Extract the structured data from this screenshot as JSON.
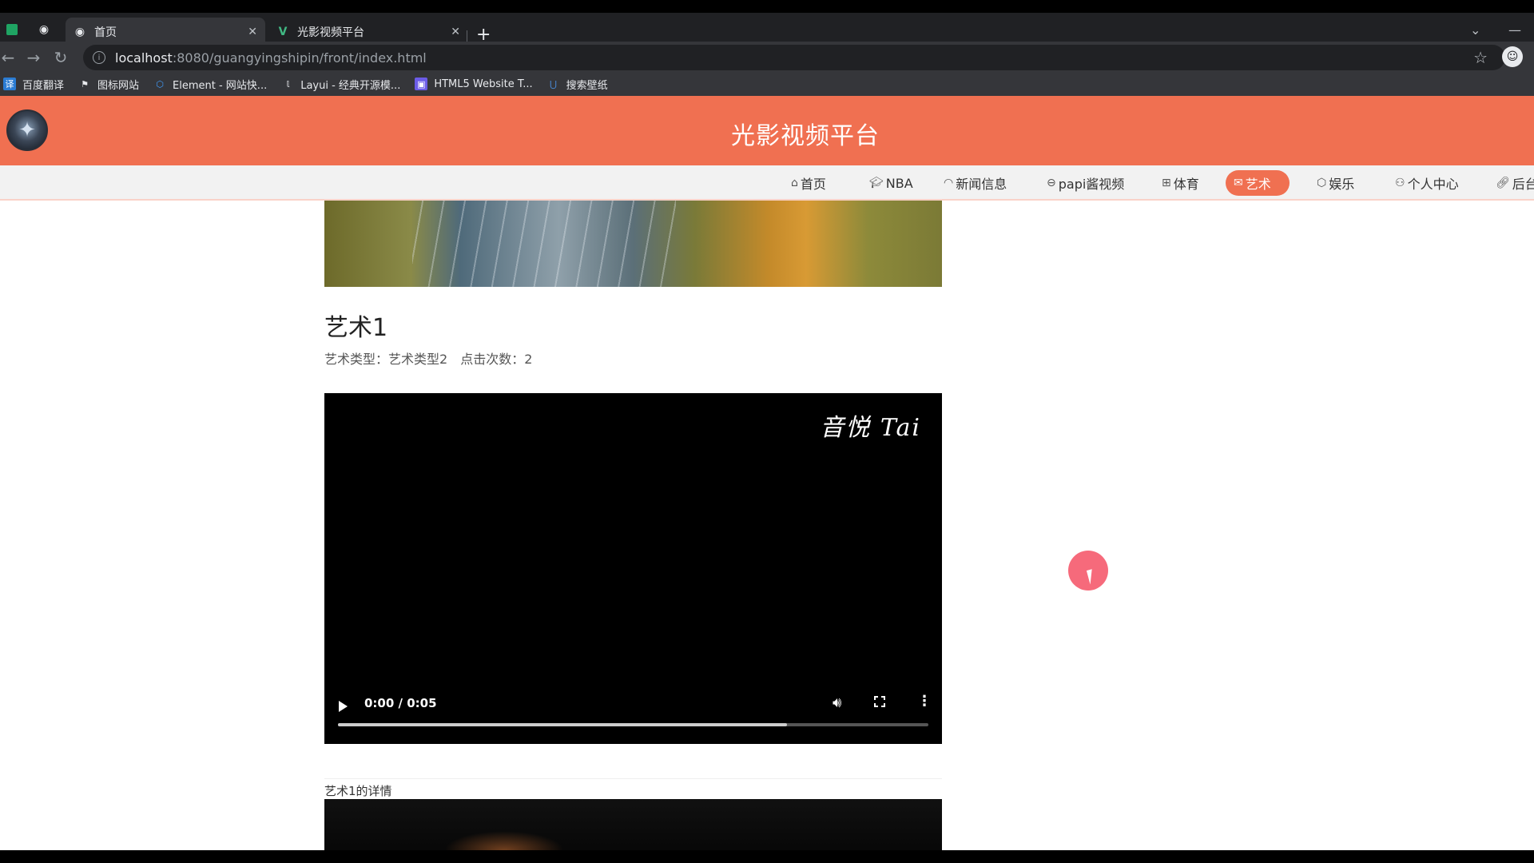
{
  "browser": {
    "tabs": [
      {
        "title": "首页",
        "active": true
      },
      {
        "title": "光影视频平台",
        "active": false
      }
    ],
    "address": {
      "host": "localhost",
      "path": ":8080/guangyingshipin/front/index.html"
    },
    "bookmarks": [
      {
        "label": "百度翻译",
        "icon": "translate-icon",
        "color": "#2b7cd3"
      },
      {
        "label": "图标网站",
        "icon": "flag-icon",
        "color": "#e8eaed"
      },
      {
        "label": "Element - 网站快...",
        "icon": "element-icon",
        "color": "#409eff"
      },
      {
        "label": "Layui - 经典开源模...",
        "icon": "layui-icon",
        "color": "#e8eaed"
      },
      {
        "label": "HTML5 Website T...",
        "icon": "html5-icon",
        "color": "#6c5ce7"
      },
      {
        "label": "搜索壁纸",
        "icon": "wallpaper-icon",
        "color": "#4a90e2"
      }
    ]
  },
  "site": {
    "title": "光影视频平台",
    "accent": "#f07051",
    "nav": [
      {
        "label": "首页",
        "icon": "home-icon",
        "active": false
      },
      {
        "label": "NBA",
        "icon": "graduation-cap-icon",
        "active": false
      },
      {
        "label": "新闻信息",
        "icon": "message-icon",
        "active": false
      },
      {
        "label": "papi酱视频",
        "icon": "media-icon",
        "active": false
      },
      {
        "label": "体育",
        "icon": "grid-icon",
        "active": false
      },
      {
        "label": "艺术",
        "icon": "mail-icon",
        "active": true
      },
      {
        "label": "娱乐",
        "icon": "box-icon",
        "active": false
      },
      {
        "label": "个人中心",
        "icon": "user-icon",
        "active": false
      },
      {
        "label": "后台",
        "icon": "link-icon",
        "active": false
      }
    ]
  },
  "article": {
    "title": "艺术1",
    "type_label": "艺术类型：",
    "type_value": "艺术类型2",
    "clicks_label": "点击次数：",
    "clicks_value": "2",
    "video": {
      "watermark": "音悦 Tai",
      "time": "0:00 / 0:05",
      "progress": 0.76
    },
    "detail_label": "艺术1的详情"
  }
}
